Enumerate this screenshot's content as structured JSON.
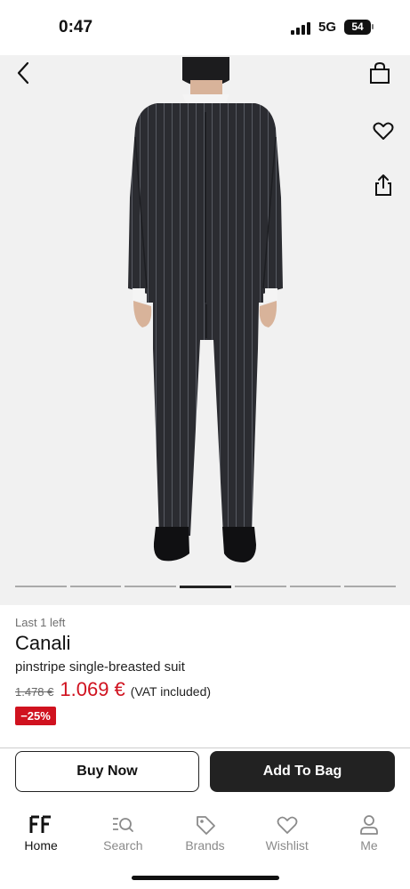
{
  "status_bar": {
    "time": "0:47",
    "network": "5G",
    "battery": "54"
  },
  "product": {
    "image_icon": "suit-model-back-view",
    "carousel": {
      "count": 7,
      "active_index": 3
    },
    "stock_note": "Last 1 left",
    "brand": "Canali",
    "description": "pinstripe single-breasted suit",
    "old_price": "1.478 €",
    "price": "1.069 €",
    "vat_note": "(VAT included)",
    "discount": "−25%",
    "price_color": "#d0121f"
  },
  "actions": {
    "buy_now": "Buy Now",
    "add_to_bag": "Add To Bag"
  },
  "tabs": [
    {
      "label": "Home",
      "icon": "farfetch-logo-icon",
      "active": true
    },
    {
      "label": "Search",
      "icon": "search-icon",
      "active": false
    },
    {
      "label": "Brands",
      "icon": "tag-icon",
      "active": false
    },
    {
      "label": "Wishlist",
      "icon": "heart-icon",
      "active": false
    },
    {
      "label": "Me",
      "icon": "person-icon",
      "active": false
    }
  ]
}
